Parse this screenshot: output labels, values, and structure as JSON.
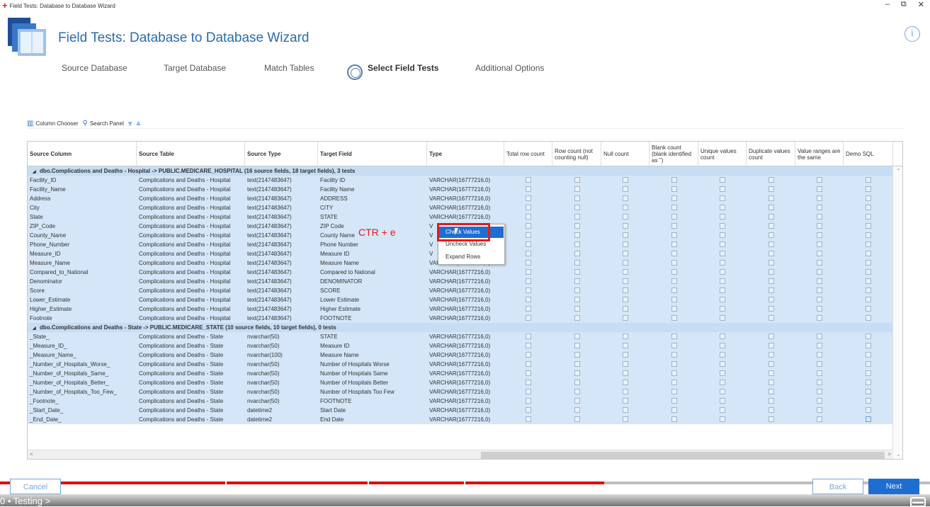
{
  "window": {
    "title": "Field Tests: Database to Database Wizard"
  },
  "header": {
    "title": "Field Tests: Database to Database Wizard"
  },
  "steps": [
    "Source Database",
    "Target Database",
    "Match Tables",
    "Select Field Tests",
    "Additional Options"
  ],
  "active_step_index": 3,
  "toolbar": {
    "column_chooser": "Column Chooser",
    "search_panel": "Search Panel"
  },
  "grid": {
    "columns": [
      "Source Column",
      "Source Table",
      "Source Type",
      "Target Field",
      "Type",
      "Total row count",
      "Row count (not counting null)",
      "Null count",
      "Blank count (blank identified as '')",
      "Unique values count",
      "Duplicate values count",
      "Value ranges are the same",
      "Demo SQL"
    ],
    "groups": [
      {
        "label": "dbo.Complications and Deaths - Hospital  -> PUBLIC.MEDICARE_HOSPITAL (16 source fields, 18 target fields), 3 tests",
        "rows": [
          [
            "Facility_ID",
            "Complications and Deaths - Hospital",
            "text(2147483647)",
            "Facility ID",
            "VARCHAR(16777216,0)"
          ],
          [
            "Facility_Name",
            "Complications and Deaths - Hospital",
            "text(2147483647)",
            "Facility Name",
            "VARCHAR(16777216,0)"
          ],
          [
            "Address",
            "Complications and Deaths - Hospital",
            "text(2147483647)",
            "ADDRESS",
            "VARCHAR(16777216,0)"
          ],
          [
            "City",
            "Complications and Deaths - Hospital",
            "text(2147483647)",
            "CITY",
            "VARCHAR(16777216,0)"
          ],
          [
            "State",
            "Complications and Deaths - Hospital",
            "text(2147483647)",
            "STATE",
            "VARCHAR(16777216,0)"
          ],
          [
            "ZIP_Code",
            "Complications and Deaths - Hospital",
            "text(2147483647)",
            "ZIP Code",
            "V"
          ],
          [
            "County_Name",
            "Complications and Deaths - Hospital",
            "text(2147483647)",
            "County Name",
            "V"
          ],
          [
            "Phone_Number",
            "Complications and Deaths - Hospital",
            "text(2147483647)",
            "Phone Number",
            "V"
          ],
          [
            "Measure_ID",
            "Complications and Deaths - Hospital",
            "text(2147483647)",
            "Measure ID",
            "V"
          ],
          [
            "Measure_Name",
            "Complications and Deaths - Hospital",
            "text(2147483647)",
            "Measure Name",
            "VARCHAR(16777216,0)"
          ],
          [
            "Compared_to_National",
            "Complications and Deaths - Hospital",
            "text(2147483647)",
            "Compared to National",
            "VARCHAR(16777216,0)"
          ],
          [
            "Denominator",
            "Complications and Deaths - Hospital",
            "text(2147483647)",
            "DENOMINATOR",
            "VARCHAR(16777216,0)"
          ],
          [
            "Score",
            "Complications and Deaths - Hospital",
            "text(2147483647)",
            "SCORE",
            "VARCHAR(16777216,0)"
          ],
          [
            "Lower_Estimate",
            "Complications and Deaths - Hospital",
            "text(2147483647)",
            "Lower Estimate",
            "VARCHAR(16777216,0)"
          ],
          [
            "Higher_Estimate",
            "Complications and Deaths - Hospital",
            "text(2147483647)",
            "Higher Estimate",
            "VARCHAR(16777216,0)"
          ],
          [
            "Footnote",
            "Complications and Deaths - Hospital",
            "text(2147483647)",
            "FOOTNOTE",
            "VARCHAR(16777216,0)"
          ]
        ]
      },
      {
        "label": "dbo.Complications and Deaths - State  -> PUBLIC.MEDICARE_STATE (10 source fields, 10 target fields), 0 tests",
        "rows": [
          [
            "_State_",
            "Complications and Deaths - State",
            "nvarchar(50)",
            "STATE",
            "VARCHAR(16777216,0)"
          ],
          [
            "_Measure_ID_",
            "Complications and Deaths - State",
            "nvarchar(50)",
            "Measure ID",
            "VARCHAR(16777216,0)"
          ],
          [
            "_Measure_Name_",
            "Complications and Deaths - State",
            "nvarchar(100)",
            "Measure Name",
            "VARCHAR(16777216,0)"
          ],
          [
            "_Number_of_Hospitals_Worse_",
            "Complications and Deaths - State",
            "nvarchar(50)",
            "Number of Hospitals Worse",
            "VARCHAR(16777216,0)"
          ],
          [
            "_Number_of_Hospitals_Same_",
            "Complications and Deaths - State",
            "nvarchar(50)",
            "Number of Hospitals Same",
            "VARCHAR(16777216,0)"
          ],
          [
            "_Number_of_Hospitals_Better_",
            "Complications and Deaths - State",
            "nvarchar(50)",
            "Number of Hospitals Better",
            "VARCHAR(16777216,0)"
          ],
          [
            "_Number_of_Hospitals_Too_Few_",
            "Complications and Deaths - State",
            "nvarchar(50)",
            "Number of Hospitals Too Few",
            "VARCHAR(16777216,0)"
          ],
          [
            "_Footnote_",
            "Complications and Deaths - State",
            "nvarchar(50)",
            "FOOTNOTE",
            "VARCHAR(16777216,0)"
          ],
          [
            "_Start_Date_",
            "Complications and Deaths - State",
            "datetime2",
            "Start Date",
            "VARCHAR(16777216,0)"
          ],
          [
            "_End_Date_",
            "Complications and Deaths - State",
            "datetime2",
            "End Date",
            "VARCHAR(16777216,0)"
          ]
        ]
      }
    ]
  },
  "context_menu": {
    "items": [
      "Check Values",
      "Uncheck Values",
      "Expand Rows"
    ],
    "selected": "Check Values"
  },
  "annotation": "CTR + e",
  "footer": {
    "cancel": "Cancel",
    "back": "Back",
    "next": "Next"
  },
  "video": {
    "chapter": "0 • Testing >",
    "progress": 0.65
  },
  "colors": {
    "accent": "#2b6cb0",
    "selection": "#1e6ed2",
    "highlight": "#e21b1b",
    "row_bg": "#d4e6f7"
  }
}
